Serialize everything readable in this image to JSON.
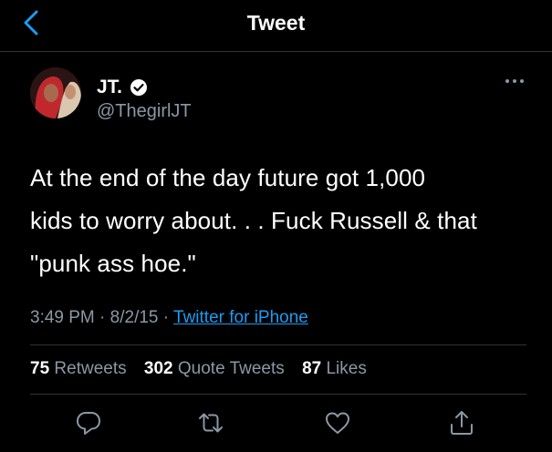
{
  "header": {
    "title": "Tweet"
  },
  "author": {
    "name": "JT.",
    "handle": "@ThegirlJT"
  },
  "tweet": {
    "lines": [
      "At the end of the day future got 1,000",
      "kids to worry about. . . Fuck Russell & that",
      "\"punk ass hoe.\""
    ],
    "time": "3:49 PM",
    "date": "8/2/15",
    "separator": "·",
    "source": "Twitter for iPhone"
  },
  "stats": {
    "retweets": {
      "count": "75",
      "label": "Retweets"
    },
    "quotes": {
      "count": "302",
      "label": "Quote Tweets"
    },
    "likes": {
      "count": "87",
      "label": "Likes"
    }
  },
  "colors": {
    "background": "#000000",
    "accent": "#1d9bf0",
    "secondary_text": "#8b98a5",
    "divider": "#2f3336"
  },
  "icons": [
    "back-chevron-icon",
    "verified-badge-icon",
    "more-options-icon",
    "reply-icon",
    "retweet-icon",
    "like-icon",
    "share-icon"
  ]
}
